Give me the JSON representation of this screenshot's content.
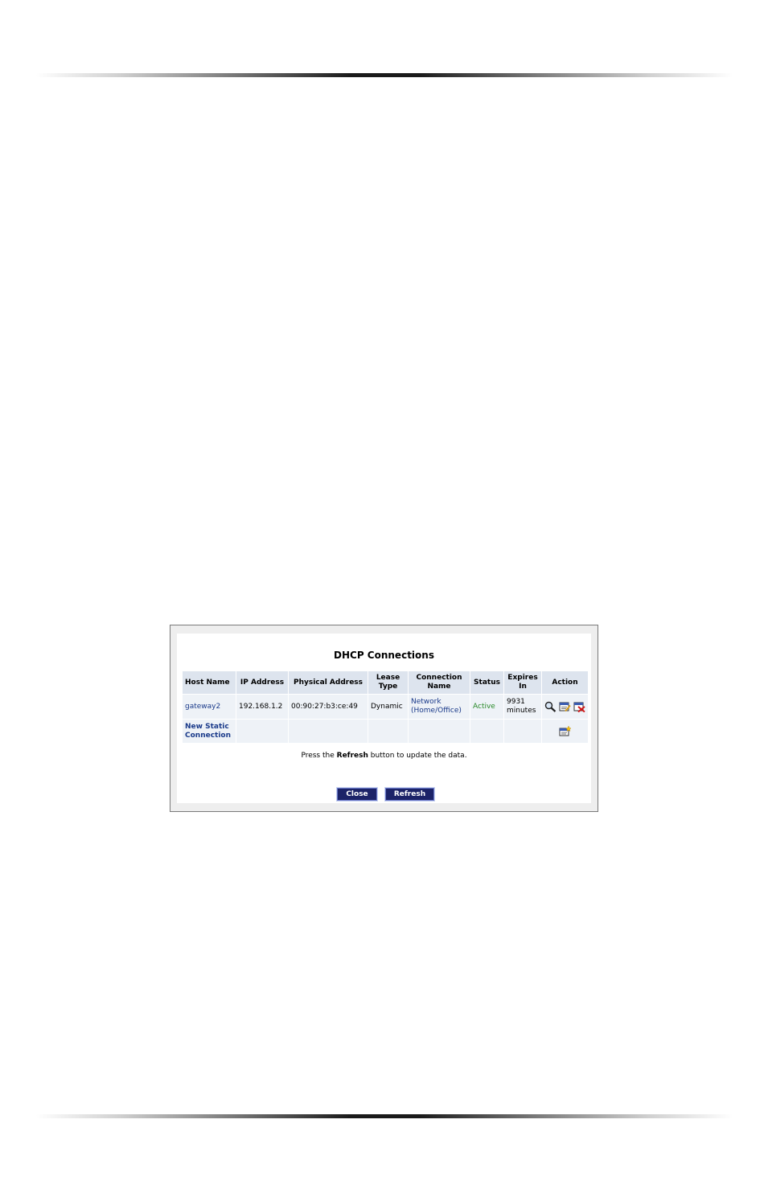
{
  "dialog": {
    "title": "DHCP Connections",
    "columns": [
      "Host Name",
      "IP Address",
      "Physical Address",
      "Lease Type",
      "Connection Name",
      "Status",
      "Expires In",
      "Action"
    ],
    "rows": [
      {
        "host_name": "gateway2",
        "ip_address": "192.168.1.2",
        "physical_address": "00:90:27:b3:ce:49",
        "lease_type": "Dynamic",
        "connection_name": "Network (Home/Office)",
        "status": "Active",
        "expires_in": "9931 minutes",
        "actions": [
          "details-icon",
          "edit-icon",
          "delete-icon"
        ]
      }
    ],
    "new_static_label": "New Static Connection",
    "new_static_action_icon": "add-entry-icon",
    "note_prefix": "Press the",
    "note_bold": "Refresh",
    "note_suffix": "button to update the data.",
    "close_label": "Close",
    "refresh_label": "Refresh"
  },
  "colors": {
    "header_bg": "#dde4ee",
    "cell_bg": "#eef2f7",
    "link": "#1a3a8a",
    "active": "#2a8a2a",
    "button_bg": "#1c2368"
  }
}
